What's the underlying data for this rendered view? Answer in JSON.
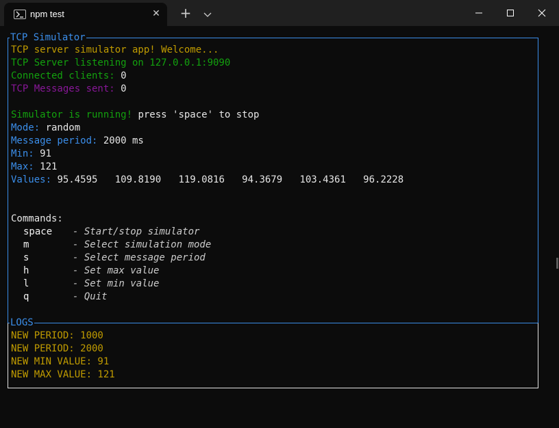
{
  "window": {
    "tab_title": "npm test",
    "tab_close_glyph": "✕",
    "new_tab_glyph": "+"
  },
  "terminal": {
    "main_box_title": "TCP Simulator",
    "welcome": "TCP server simulator app! Welcome...",
    "listening": "TCP Server listening on 127.0.0.1:9090",
    "clients_label": "Connected clients: ",
    "clients_value": "0",
    "messages_label": "TCP Messages sent: ",
    "messages_value": "0",
    "running_label": "Simulator is running!",
    "running_hint": " press 'space' to stop",
    "mode_label": "Mode: ",
    "mode_value": "random",
    "period_label": "Message period: ",
    "period_value": "2000 ms",
    "min_label": "Min: ",
    "min_value": "91",
    "max_label": "Max: ",
    "max_value": "121",
    "values_label": "Values: ",
    "values_list": "95.4595   109.8190   119.0816   94.3679   103.4361   96.2228",
    "commands_header": "Commands:",
    "commands": [
      {
        "key": "space",
        "desc": "- Start/stop simulator"
      },
      {
        "key": "m",
        "desc": "- Select simulation mode"
      },
      {
        "key": "s",
        "desc": "- Select message period"
      },
      {
        "key": "h",
        "desc": "- Set max value"
      },
      {
        "key": "l",
        "desc": "- Set min value"
      },
      {
        "key": "q",
        "desc": "- Quit"
      }
    ],
    "logs_box_title": "LOGS",
    "logs": [
      "NEW PERIOD: 1000",
      "NEW PERIOD: 2000",
      "NEW MIN VALUE: 91",
      "NEW MAX VALUE: 121"
    ]
  },
  "colors": {
    "border_blue": "#3b8eea",
    "yellow": "#c19c00",
    "green": "#13a10e",
    "purple": "#881798",
    "background": "#0c0c0c"
  }
}
